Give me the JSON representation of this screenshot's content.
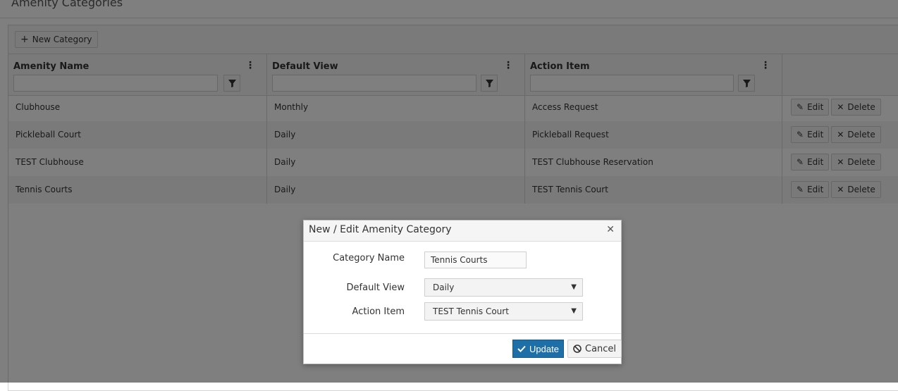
{
  "page": {
    "title": "Amenity Categories"
  },
  "toolbar": {
    "new_category_label": "New Category"
  },
  "columns": [
    {
      "title": "Amenity Name"
    },
    {
      "title": "Default View"
    },
    {
      "title": "Action Item"
    }
  ],
  "rows": [
    {
      "name": "Clubhouse",
      "view": "Monthly",
      "action": "Access Request"
    },
    {
      "name": "Pickleball Court",
      "view": "Daily",
      "action": "Pickleball Request"
    },
    {
      "name": "TEST Clubhouse",
      "view": "Daily",
      "action": "TEST Clubhouse Reservation"
    },
    {
      "name": "Tennis Courts",
      "view": "Daily",
      "action": "TEST Tennis Court"
    }
  ],
  "row_buttons": {
    "edit": "Edit",
    "delete": "Delete"
  },
  "dialog": {
    "title": "New / Edit Amenity Category",
    "category_name_label": "Category Name",
    "category_name_value": "Tennis Courts",
    "default_view_label": "Default View",
    "default_view_value": "Daily",
    "action_item_label": "Action Item",
    "action_item_value": "TEST Tennis Court",
    "update_label": "Update",
    "cancel_label": "Cancel"
  },
  "colors": {
    "primary": "#1e6ea8",
    "overlay": "rgba(0,0,0,0.5)"
  }
}
